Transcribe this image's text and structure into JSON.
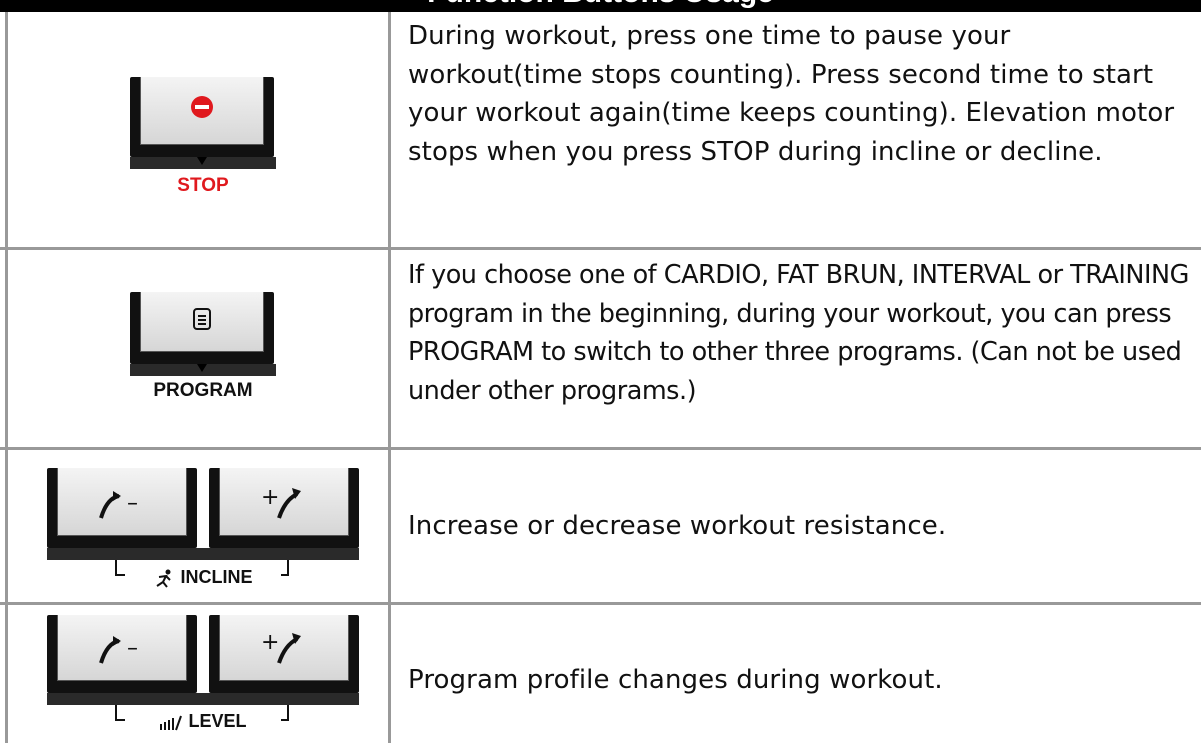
{
  "header": {
    "title": "Function Buttons Usage"
  },
  "rows": [
    {
      "key_label": "STOP",
      "key_label_color": "#e0191e",
      "key_icon": "stop-circle-icon",
      "description": "During workout, press one time to pause your workout(time stops counting). Press second time to start your workout again(time keeps counting). Elevation motor stops when you press STOP during incline or decline."
    },
    {
      "key_label": "PROGRAM",
      "key_label_color": "#111111",
      "key_icon": "program-icon",
      "description": "If you choose one of CARDIO, FAT BRUN, INTERVAL or TRAINING program in the beginning, during your workout, you can press PROGRAM to switch to other three programs. (Can not be used under other programs.)"
    },
    {
      "key_label": "INCLINE",
      "group_icon": "runner-icon",
      "minus_label": "–",
      "plus_label": "+",
      "description": "Increase or decrease workout resistance."
    },
    {
      "key_label": "LEVEL",
      "group_icon": "level-bars-icon",
      "minus_label": "–",
      "plus_label": "+",
      "description": "Program profile changes during workout."
    }
  ]
}
